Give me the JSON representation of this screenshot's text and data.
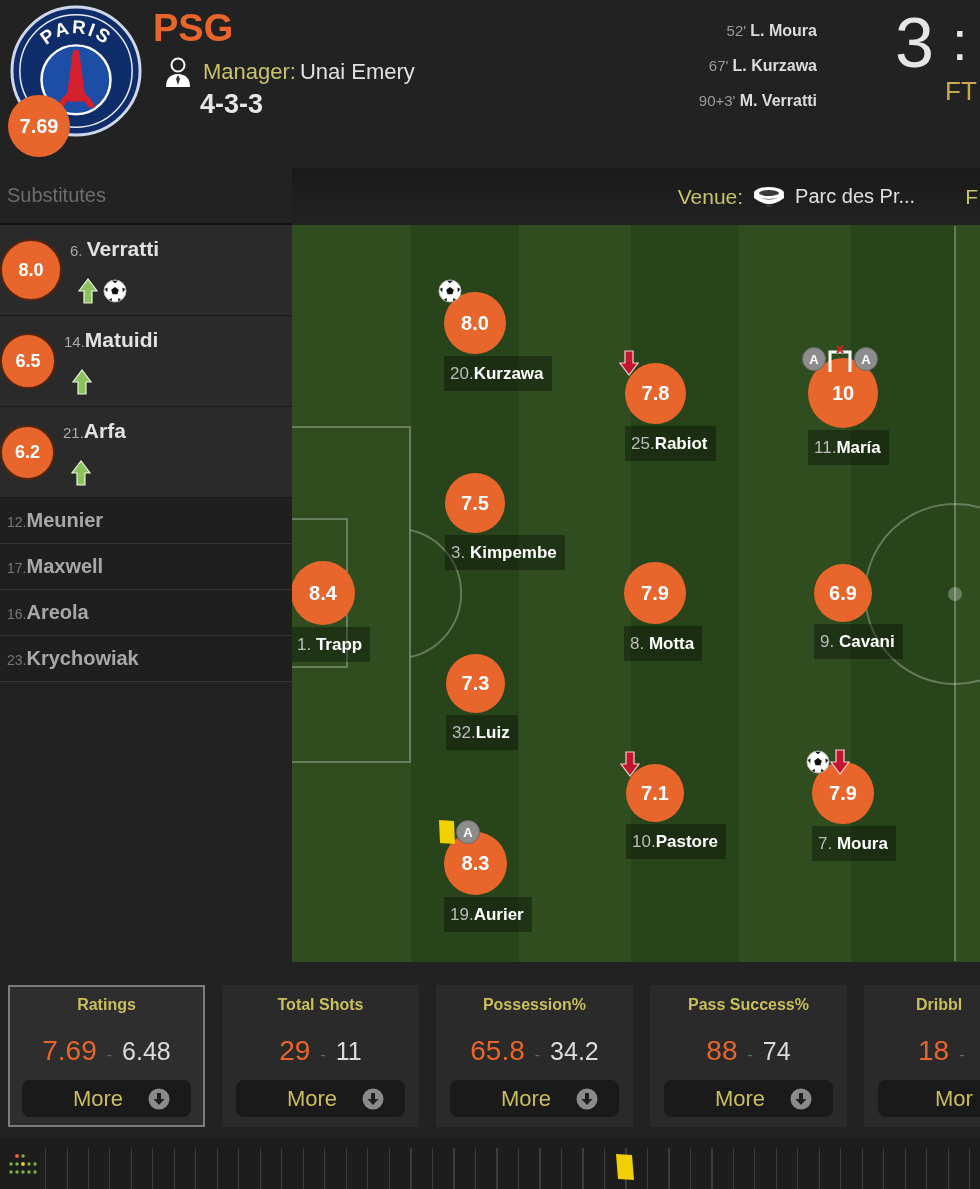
{
  "header": {
    "crest": {
      "text": "PARIS"
    },
    "team_rating": "7.69",
    "team_name": "PSG",
    "manager_label": "Manager:",
    "manager": "Unai Emery",
    "formation": "4-3-3",
    "goals": [
      "52' **L. Moura**",
      "67' **L. Kurzawa**",
      "90+3' **M. Verratti**"
    ],
    "score": "3",
    "score_separator": ":",
    "status": "FT"
  },
  "info_bar": {
    "venue_label": "Venue:",
    "venue": "Parc des Pr...",
    "item_3": "F"
  },
  "substitutes": {
    "title": "Substitutes",
    "players": [
      {
        "kind": "played",
        "label": "6. **Verratti**",
        "rating": "8.0",
        "events": [
          {
            "kind": "sub_on"
          },
          {
            "kind": "goal"
          }
        ]
      },
      {
        "kind": "played",
        "label": "14.**Matuidi**",
        "rating": "6.5",
        "events": [
          {
            "kind": "sub_on"
          }
        ]
      },
      {
        "kind": "played",
        "label": "21.**Arfa**",
        "rating": "6.2",
        "events": [
          {
            "kind": "sub_on"
          }
        ]
      },
      {
        "kind": "unused",
        "label": "12.**Meunier**"
      },
      {
        "kind": "unused",
        "label": "17.**Maxwell**"
      },
      {
        "kind": "unused",
        "label": "16.**Areola**"
      },
      {
        "kind": "unused",
        "label": "23.**Krychowiak**"
      }
    ]
  },
  "pitch": {
    "lines": [
      {
        "players": [
          {
            "label": "1. **Trapp**",
            "rating": "8.4"
          }
        ]
      },
      {
        "players": [
          {
            "label": "20.**Kurzawa**",
            "rating": "8.0",
            "events": [
              {
                "kind": "goal"
              }
            ]
          },
          {
            "label": "3. **Kimpembe**",
            "rating": "7.5"
          },
          {
            "label": "32.**Luiz**",
            "rating": "7.3"
          },
          {
            "label": "19.**Aurier**",
            "rating": "8.3",
            "events": [
              {
                "kind": "yellow_card"
              },
              {
                "kind": "assist",
                "label": "A"
              }
            ]
          }
        ]
      },
      {
        "players": [
          {
            "label": "25.**Rabiot**",
            "rating": "7.8",
            "events": [
              {
                "kind": "sub_off"
              }
            ]
          },
          {
            "label": "8. **Motta**",
            "rating": "7.9"
          },
          {
            "label": "10.**Pastore**",
            "rating": "7.1",
            "events": [
              {
                "kind": "sub_off"
              }
            ]
          }
        ]
      },
      {
        "players": [
          {
            "label": "11.**María**",
            "rating": "10",
            "events": [
              {
                "kind": "assist",
                "label": "A"
              },
              {
                "kind": "woodwork"
              },
              {
                "kind": "assist",
                "label": "A"
              }
            ]
          },
          {
            "label": "9. **Cavani**",
            "rating": "6.9"
          },
          {
            "label": "7. **Moura**",
            "rating": "7.9",
            "events": [
              {
                "kind": "goal"
              },
              {
                "kind": "sub_off"
              }
            ]
          }
        ]
      }
    ]
  },
  "stats": [
    {
      "title": "Ratings",
      "home": "7.69",
      "separator": "-",
      "away": "6.48",
      "button": "More",
      "selected": true
    },
    {
      "title": "Total Shots",
      "home": "29",
      "separator": "-",
      "away": "11",
      "button": "More",
      "selected": false
    },
    {
      "title": "Possession%",
      "home": "65.8",
      "separator": "-",
      "away": "34.2",
      "button": "More",
      "selected": false
    },
    {
      "title": "Pass Success%",
      "home": "88",
      "separator": "-",
      "away": "74",
      "button": "More",
      "selected": false
    },
    {
      "title": "Dribbl",
      "home": "18",
      "separator": "-",
      "button": "Mor",
      "selected": false
    }
  ],
  "timeline": {
    "events": [
      {
        "kind": "yellow_card",
        "level": 0.62
      }
    ]
  }
}
